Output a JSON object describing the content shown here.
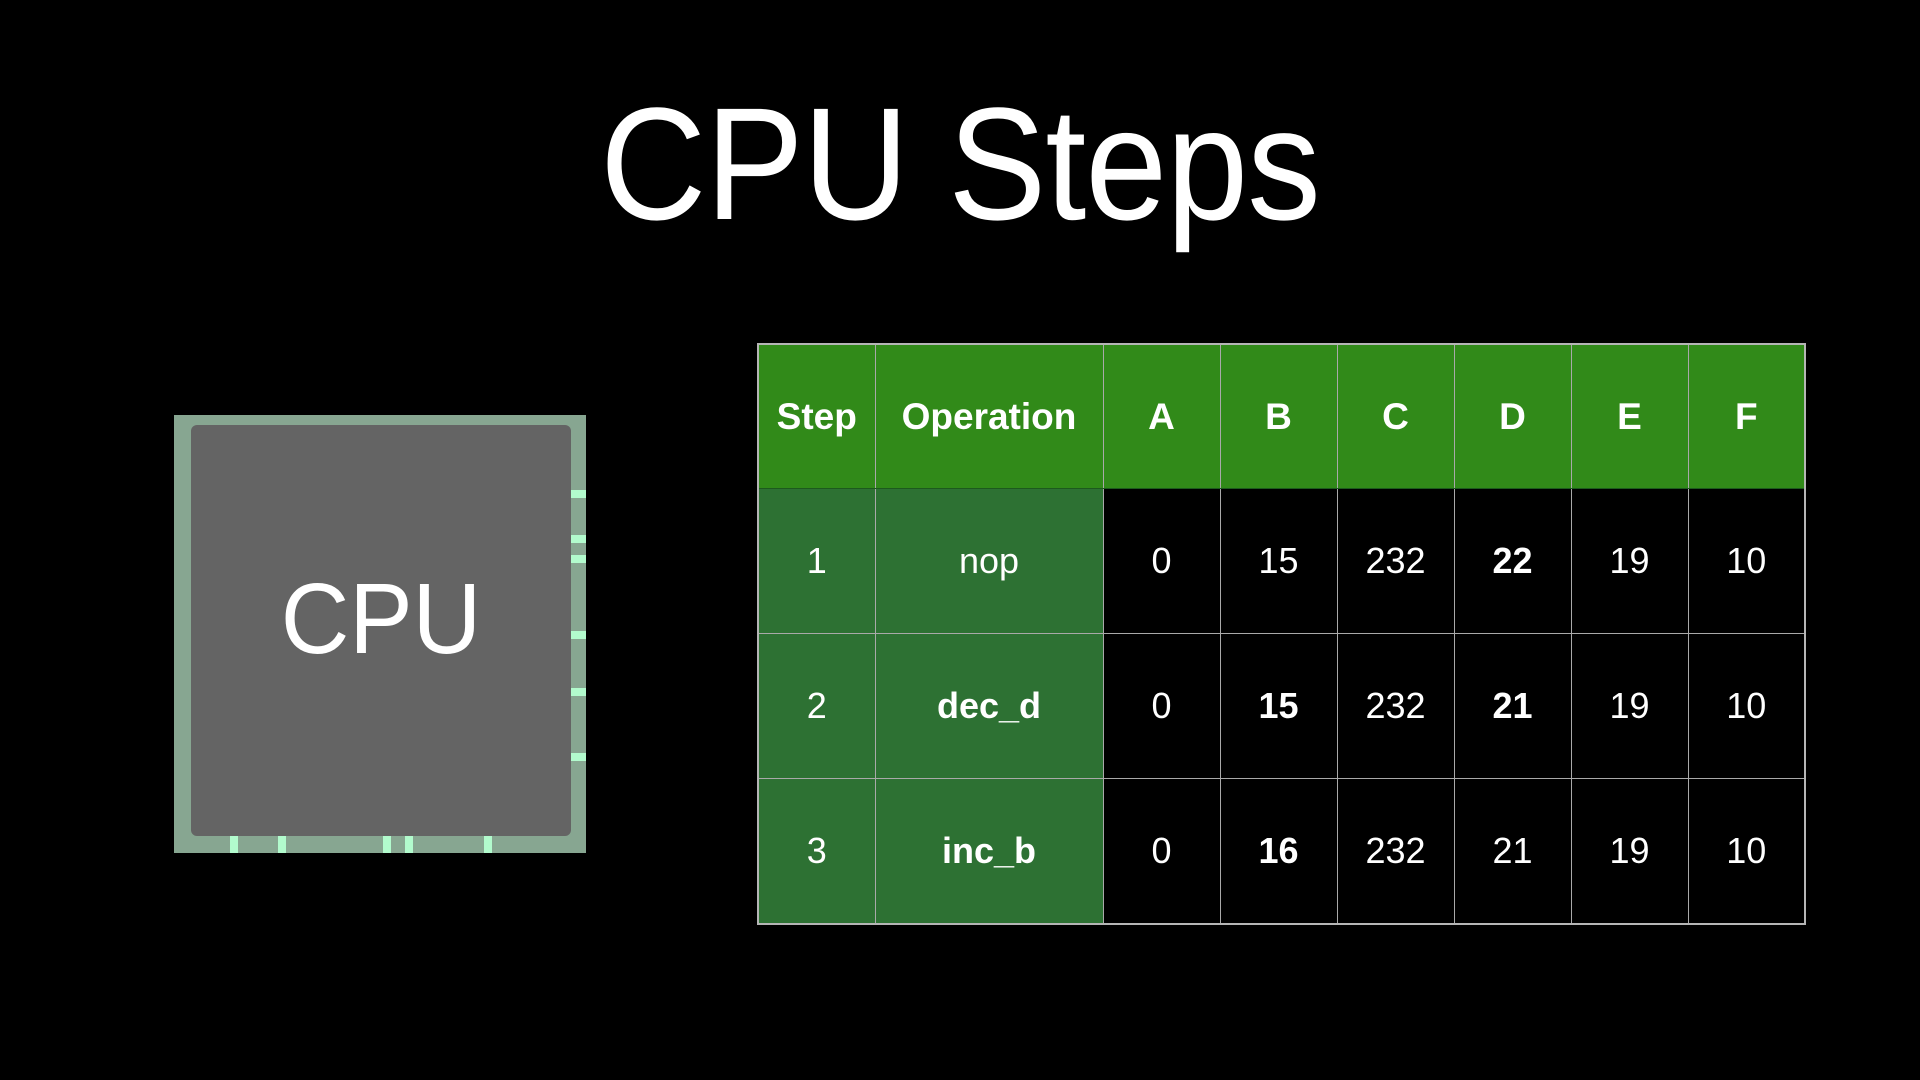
{
  "title": "CPU Steps",
  "cpu": {
    "label": "CPU",
    "right_pin_count": 6,
    "bottom_pin_count": 5
  },
  "colors": {
    "background": "#000000",
    "header_green": "#318a19",
    "label_cell_green": "#2d7133",
    "chip_border": "#87a691",
    "chip_core": "#646464",
    "chip_pins": "#b2fbcd",
    "grid_lines": "#a9a9a9"
  },
  "table": {
    "headers": [
      "Step",
      "Operation",
      "A",
      "B",
      "C",
      "D",
      "E",
      "F"
    ],
    "rows": [
      {
        "step": "1",
        "operation": "nop",
        "operation_bold": false,
        "registers": [
          {
            "value": "0",
            "bold": false
          },
          {
            "value": "15",
            "bold": false
          },
          {
            "value": "232",
            "bold": false
          },
          {
            "value": "22",
            "bold": true
          },
          {
            "value": "19",
            "bold": false
          },
          {
            "value": "10",
            "bold": false
          }
        ]
      },
      {
        "step": "2",
        "operation": "dec_d",
        "operation_bold": true,
        "registers": [
          {
            "value": "0",
            "bold": false
          },
          {
            "value": "15",
            "bold": true
          },
          {
            "value": "232",
            "bold": false
          },
          {
            "value": "21",
            "bold": true
          },
          {
            "value": "19",
            "bold": false
          },
          {
            "value": "10",
            "bold": false
          }
        ]
      },
      {
        "step": "3",
        "operation": "inc_b",
        "operation_bold": true,
        "registers": [
          {
            "value": "0",
            "bold": false
          },
          {
            "value": "16",
            "bold": true
          },
          {
            "value": "232",
            "bold": false
          },
          {
            "value": "21",
            "bold": false
          },
          {
            "value": "19",
            "bold": false
          },
          {
            "value": "10",
            "bold": false
          }
        ]
      }
    ]
  }
}
